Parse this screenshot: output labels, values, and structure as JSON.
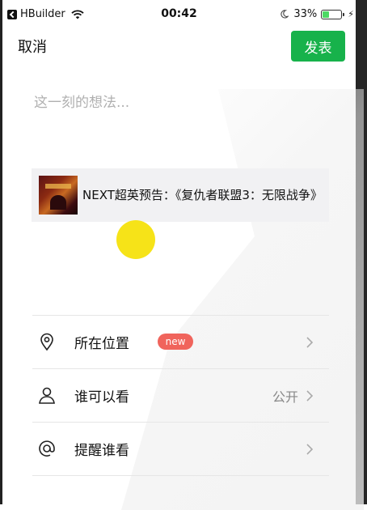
{
  "status_bar": {
    "app_name": "HBuilder",
    "time": "00:42",
    "battery_percent": "33%",
    "battery_level": 0.33,
    "icons": [
      "back-icon",
      "wifi-icon",
      "moon-icon",
      "battery-icon",
      "charging-bolt-icon"
    ]
  },
  "header": {
    "cancel_label": "取消",
    "publish_label": "发表"
  },
  "composer": {
    "placeholder": "这一刻的想法...",
    "value": ""
  },
  "link_card": {
    "title": "NEXT超英预告：《复仇者联盟3：无限战争》"
  },
  "options": [
    {
      "label": "所在位置",
      "badge": "new",
      "value": "",
      "icon": "location-pin-icon"
    },
    {
      "label": "谁可以看",
      "badge": "",
      "value": "公开",
      "icon": "person-icon"
    },
    {
      "label": "提醒谁看",
      "badge": "",
      "value": "",
      "icon": "at-icon"
    }
  ],
  "colors": {
    "accent": "#17b24b",
    "badge": "#f0645c",
    "touch_indicator": "#f6e318"
  }
}
